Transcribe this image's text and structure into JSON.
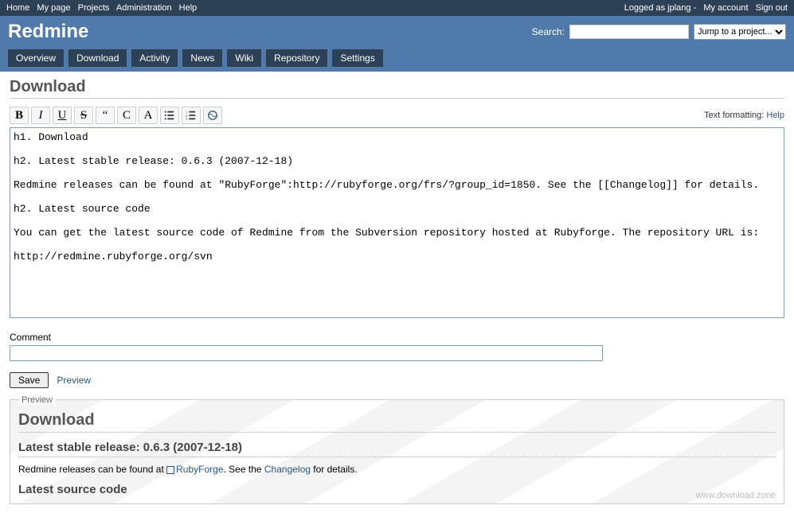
{
  "topMenu": {
    "left": [
      "Home",
      "My page",
      "Projects",
      "Administration",
      "Help"
    ],
    "loggedAs": "Logged as jplang -",
    "right": [
      "My account",
      "Sign out"
    ]
  },
  "header": {
    "title": "Redmine",
    "searchLabel": "Search:",
    "jumpProject": "Jump to a project..."
  },
  "mainMenu": [
    "Overview",
    "Download",
    "Activity",
    "News",
    "Wiki",
    "Repository",
    "Settings"
  ],
  "page": {
    "title": "Download",
    "formattingLabel": "Text formatting:",
    "helpLink": "Help",
    "editorContent": "h1. Download\n\nh2. Latest stable release: 0.6.3 (2007-12-18)\n\nRedmine releases can be found at \"RubyForge\":http://rubyforge.org/frs/?group_id=1850. See the [[Changelog]] for details.\n\nh2. Latest source code\n\nYou can get the latest source code of Redmine from the Subversion repository hosted at Rubyforge. The repository URL is:\n\nhttp://redmine.rubyforge.org/svn",
    "commentLabel": "Comment",
    "saveButton": "Save",
    "previewLink": "Preview"
  },
  "preview": {
    "legend": "Preview",
    "h1": "Download",
    "h2a": "Latest stable release: 0.6.3 (2007-12-18)",
    "p1_pre": "Redmine releases can be found at ",
    "p1_link1": "RubyForge",
    "p1_mid": ". See the ",
    "p1_link2": "Changelog",
    "p1_post": " for details.",
    "h2b": "Latest source code"
  },
  "watermark": "www.download.zone"
}
